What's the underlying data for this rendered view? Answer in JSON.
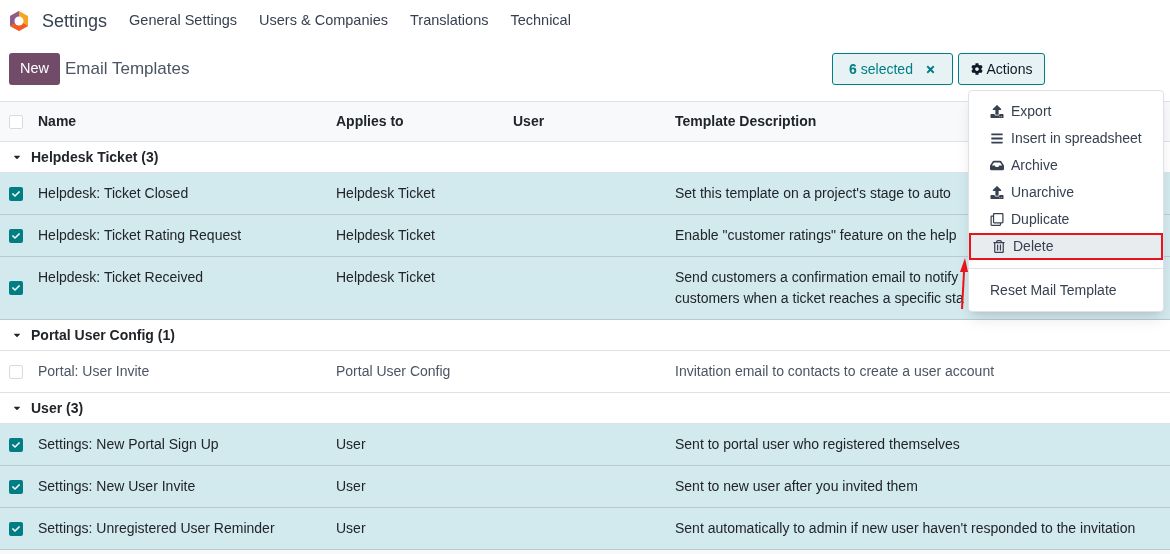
{
  "app": {
    "name": "Settings"
  },
  "menu": [
    "General Settings",
    "Users & Companies",
    "Translations",
    "Technical"
  ],
  "new_button": "New",
  "breadcrumb": "Email Templates",
  "selection": {
    "count": "6",
    "label": "selected"
  },
  "actions_button": "Actions",
  "table": {
    "columns": [
      "Name",
      "Applies to",
      "User",
      "Template Description"
    ],
    "all_selected": false,
    "groups": [
      {
        "label": "Helpdesk Ticket (3)",
        "expanded": true,
        "rows": [
          {
            "name": "Helpdesk: Ticket Closed",
            "applies_to": "Helpdesk Ticket",
            "description": [
              "Set this template on a project's stage to auto"
            ],
            "selected": true
          },
          {
            "name": "Helpdesk: Ticket Rating Request",
            "applies_to": "Helpdesk Ticket",
            "description": [
              "Enable \"customer ratings\" feature on the help"
            ],
            "selected": true
          },
          {
            "name": "Helpdesk: Ticket Received",
            "applies_to": "Helpdesk Ticket",
            "description": [
              "Send customers a confirmation email to notify",
              "customers when a ticket reaches a specific sta"
            ],
            "selected": true
          }
        ]
      },
      {
        "label": "Portal User Config (1)",
        "expanded": true,
        "rows": [
          {
            "name": "Portal: User Invite",
            "applies_to": "Portal User Config",
            "description": [
              "Invitation email to contacts to create a user account"
            ],
            "selected": false
          }
        ]
      },
      {
        "label": "User (3)",
        "expanded": true,
        "rows": [
          {
            "name": "Settings: New Portal Sign Up",
            "applies_to": "User",
            "description": [
              "Sent to portal user who registered themselves"
            ],
            "selected": true
          },
          {
            "name": "Settings: New User Invite",
            "applies_to": "User",
            "description": [
              "Sent to new user after you invited them"
            ],
            "selected": true
          },
          {
            "name": "Settings: Unregistered User Reminder",
            "applies_to": "User",
            "description": [
              "Sent automatically to admin if new user haven't responded to the invitation"
            ],
            "selected": true
          }
        ]
      }
    ]
  },
  "actions_menu": {
    "items": [
      {
        "label": "Export",
        "highlighted": false
      },
      {
        "label": "Insert in spreadsheet",
        "highlighted": false
      },
      {
        "label": "Archive",
        "highlighted": false
      },
      {
        "label": "Unarchive",
        "highlighted": false
      },
      {
        "label": "Duplicate",
        "highlighted": false
      },
      {
        "label": "Delete",
        "highlighted": true
      }
    ],
    "extra": [
      {
        "label": "Reset Mail Template"
      }
    ]
  }
}
